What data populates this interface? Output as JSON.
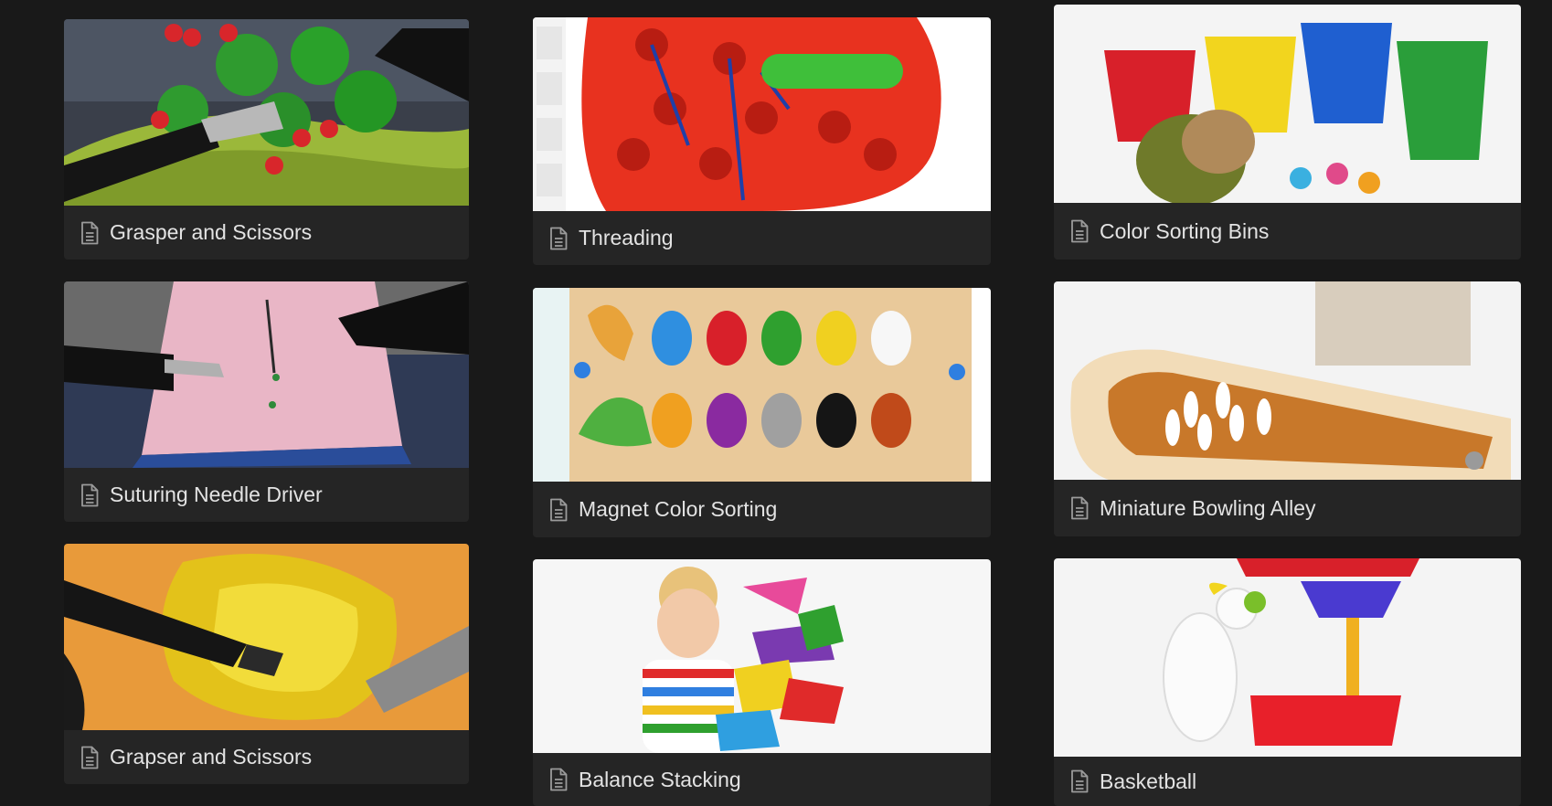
{
  "gallery": {
    "cards": [
      {
        "title": "Grasper and Scissors",
        "icon": "page-icon"
      },
      {
        "title": "Threading",
        "icon": "page-icon"
      },
      {
        "title": "Color Sorting Bins",
        "icon": "page-icon"
      },
      {
        "title": "Suturing Needle Driver",
        "icon": "page-icon"
      },
      {
        "title": "Magnet Color Sorting",
        "icon": "page-icon"
      },
      {
        "title": "Miniature Bowling Alley",
        "icon": "page-icon"
      },
      {
        "title": "Grapser and Scissors",
        "icon": "page-icon"
      },
      {
        "title": "Balance Stacking",
        "icon": "page-icon"
      },
      {
        "title": "Basketball",
        "icon": "page-icon"
      }
    ]
  },
  "colors": {
    "background": "#191919",
    "card": "#252525",
    "text": "#e3e3e3"
  }
}
